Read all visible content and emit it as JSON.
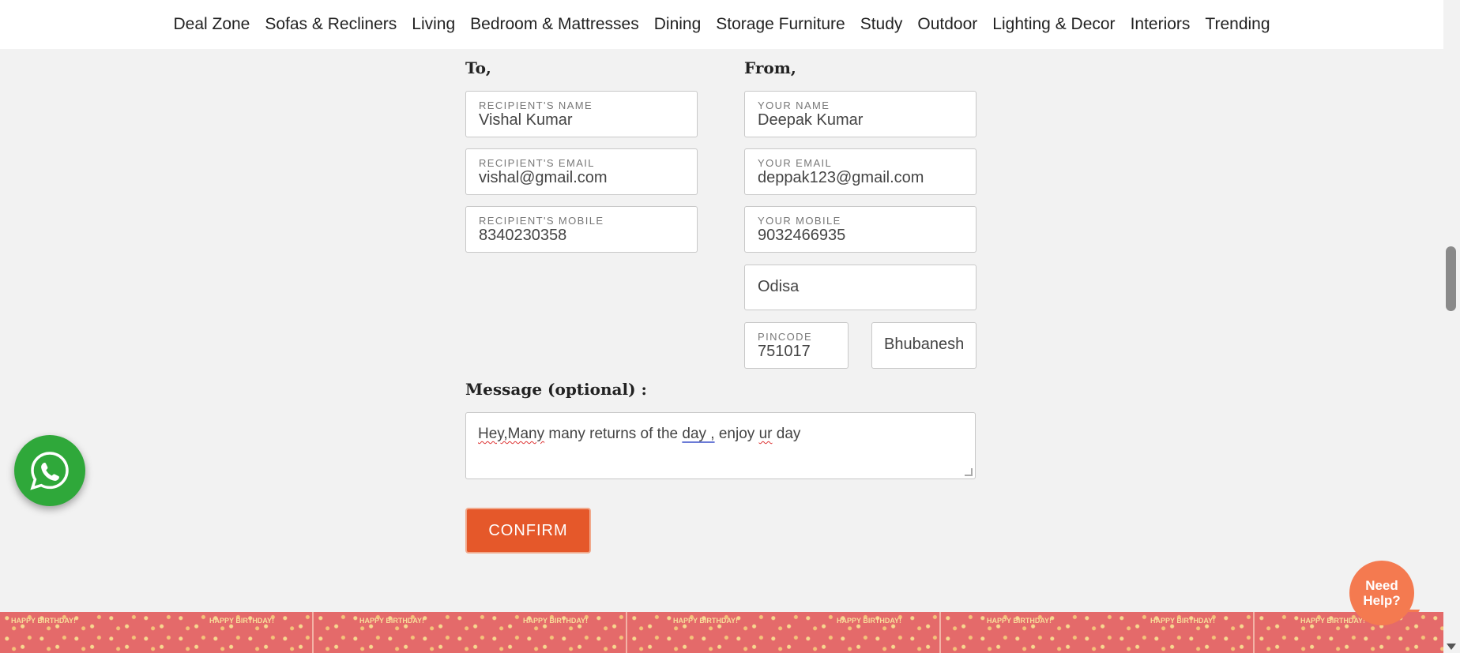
{
  "nav": {
    "items": [
      "Deal Zone",
      "Sofas & Recliners",
      "Living",
      "Bedroom & Mattresses",
      "Dining",
      "Storage Furniture",
      "Study",
      "Outdoor",
      "Lighting & Decor",
      "Interiors",
      "Trending"
    ]
  },
  "form": {
    "to_heading": "To,",
    "from_heading": "From,",
    "recipient_name": {
      "label": "RECIPIENT'S NAME",
      "value": "Vishal Kumar"
    },
    "recipient_email": {
      "label": "RECIPIENT'S EMAIL",
      "value": "vishal@gmail.com"
    },
    "recipient_mobile": {
      "label": "RECIPIENT'S MOBILE",
      "value": "8340230358"
    },
    "your_name": {
      "label": "YOUR NAME",
      "value": "Deepak Kumar"
    },
    "your_email": {
      "label": "YOUR EMAIL",
      "value": "deppak123@gmail.com"
    },
    "your_mobile": {
      "label": "YOUR MOBILE",
      "value": "9032466935"
    },
    "state": {
      "value": "Odisa"
    },
    "pincode": {
      "label": "PINCODE",
      "value": "751017"
    },
    "city": {
      "value": "Bhubanesh"
    },
    "message_label": "Message (optional) :",
    "message": {
      "part1": "Hey,Many",
      "part2": " many returns of the ",
      "part3": "day ,",
      "part4": " enjoy ",
      "part5": "ur",
      "part6": " day"
    },
    "confirm_label": "CONFIRM"
  },
  "widgets": {
    "need_help": "Need Help?",
    "banner_text": "HAPPY BIRTHDAY!"
  },
  "colors": {
    "accent": "#e5582a",
    "whatsapp": "#2fa83a",
    "help": "#f47a50",
    "banner": "#e46a6a"
  }
}
